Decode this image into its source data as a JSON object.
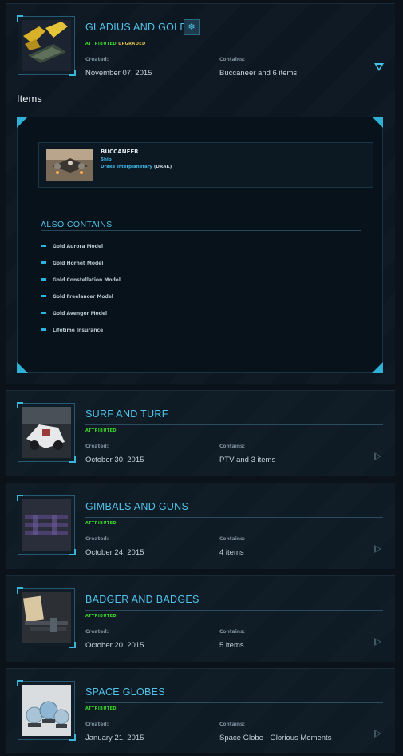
{
  "pledges": [
    {
      "title": "GLADIUS AND GOLD",
      "status": "ATTRIBUTED",
      "status_extra": "UPGRADED",
      "created_label": "Created:",
      "created": "November 07, 2015",
      "contains_label": "Contains:",
      "contains": "Buccaneer and 6 items",
      "expanded": true,
      "badge_icon": "snowflake-icon"
    },
    {
      "title": "SURF AND TURF",
      "status": "ATTRIBUTED",
      "created_label": "Created:",
      "created": "October 30, 2015",
      "contains_label": "Contains:",
      "contains": "PTV and 3 items"
    },
    {
      "title": "GIMBALS AND GUNS",
      "status": "ATTRIBUTED",
      "created_label": "Created:",
      "created": "October 24, 2015",
      "contains_label": "Contains:",
      "contains": "4 items"
    },
    {
      "title": "BADGER AND BADGES",
      "status": "ATTRIBUTED",
      "created_label": "Created:",
      "created": "October 20, 2015",
      "contains_label": "Contains:",
      "contains": "5 items"
    },
    {
      "title": "SPACE GLOBES",
      "status": "ATTRIBUTED",
      "created_label": "Created:",
      "created": "January 21, 2015",
      "contains_label": "Contains:",
      "contains": "Space Globe - Glorious Moments"
    }
  ],
  "items_section": {
    "heading": "Items",
    "ship": {
      "name": "BUCCANEER",
      "type": "Ship",
      "manufacturer": "Drake Interplanetary",
      "manufacturer_code": "(DRAK)"
    },
    "also_contains_heading": "ALSO CONTAINS",
    "also_contains": [
      "Gold Aurora Model",
      "Gold Hornet Model",
      "Gold Constellation Model",
      "Gold Freelancer Model",
      "Gold Avenger Model",
      "Lifetime Insurance"
    ]
  },
  "colors": {
    "accent": "#4fc3ea",
    "status_green": "#39d62a",
    "upgraded_gold": "#e3c14a",
    "background": "#0b1219"
  }
}
